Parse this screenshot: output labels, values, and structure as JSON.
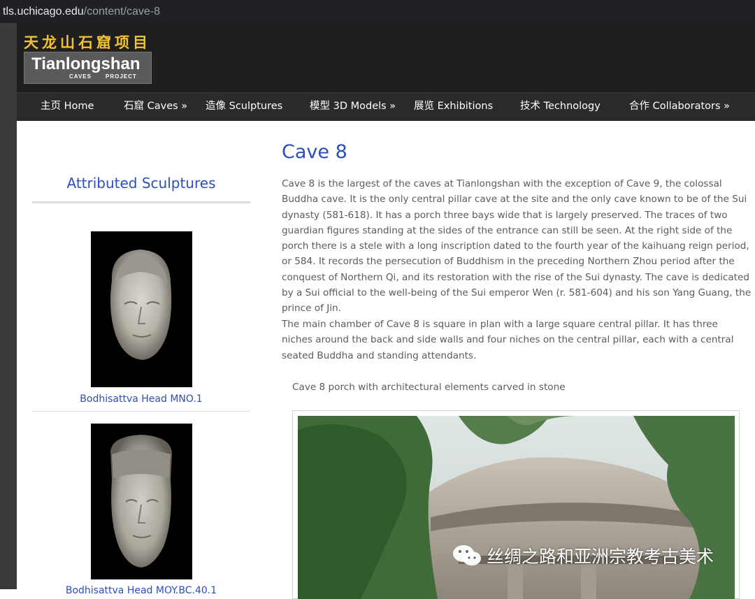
{
  "browser": {
    "url_host": "tls.uchicago.edu",
    "url_path": "/content/cave-8"
  },
  "site": {
    "logo_cn": "天龙山石窟项目",
    "logo_en": "Tianlongshan",
    "logo_sub1": "CAVES",
    "logo_sub2": "PROJECT"
  },
  "nav": [
    {
      "label": "主页 Home"
    },
    {
      "label": "石窟 Caves »"
    },
    {
      "label": "造像 Sculptures"
    },
    {
      "label": "模型 3D Models »"
    },
    {
      "label": "展览 Exhibitions"
    },
    {
      "label": "技术 Technology"
    },
    {
      "label": "合作 Collaborators »"
    }
  ],
  "sidebar": {
    "title": "Attributed Sculptures",
    "items": [
      {
        "caption": "Bodhisattva Head MNO.1"
      },
      {
        "caption": "Bodhisattva Head MOY.BC.40.1"
      }
    ]
  },
  "main": {
    "title": "Cave 8",
    "paragraph1": "Cave 8 is the largest of the caves at Tianlongshan with the exception of Cave 9, the colossal Buddha cave. It is the only central pillar cave at the site and the only cave known to be of the Sui dynasty (581-618). It has a porch three bays wide that is largely preserved. The traces of two guardian figures standing at the sides of the entrance can still be seen. At the right side of the porch there is a stele with a long inscription dated to the fourth year of the kaihuang reign period, or 584. It records the persecution of Buddhism in the preceding Northern Zhou period after the conquest of Northern Qi, and its restoration with the rise of the Sui dynasty. The cave is dedicated by a Sui official to the well-being of the Sui emperor Wen (r. 581-604) and his son Yang Guang, the prince of Jin.",
    "paragraph2": "The main chamber of Cave 8 is square in plan with a large square central pillar. It has three niches around the back and side walls and four niches on the central pillar, each with a central seated Buddha and standing attendants.",
    "figure_caption": "Cave 8 porch with architectural elements carved in stone"
  },
  "watermark": {
    "text": "丝绸之路和亚洲宗教考古美术",
    "icon": "wechat-icon"
  },
  "colors": {
    "link_blue": "#2b4fbd",
    "logo_gold": "#f2c230",
    "header_bg": "#1f1f1f",
    "nav_bg": "#2b2b2b",
    "body_text": "#5b5b5b"
  }
}
